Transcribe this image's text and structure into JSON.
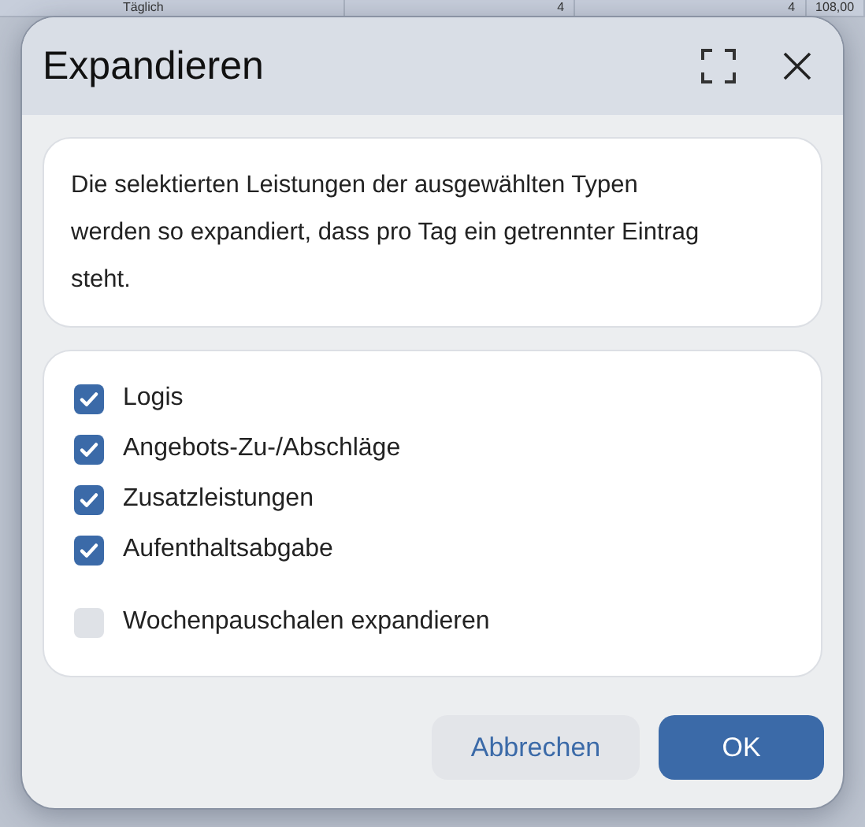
{
  "background_row": {
    "cells": [
      "Täglich",
      "4",
      "4",
      "108,00"
    ]
  },
  "dialog": {
    "title": "Expandieren",
    "description": "Die selektierten Leistungen der ausgewählten Typen werden so expandiert, dass pro Tag ein getrennter Eintrag steht.",
    "options": [
      {
        "label": "Logis",
        "checked": true
      },
      {
        "label": "Angebots-Zu-/Abschläge",
        "checked": true
      },
      {
        "label": "Zusatzleistungen",
        "checked": true
      },
      {
        "label": "Aufenthaltsabgabe",
        "checked": true
      }
    ],
    "extra_option": {
      "label": "Wochenpauschalen expandieren",
      "checked": false
    },
    "buttons": [
      {
        "label": "Abbrechen",
        "kind": "secondary"
      },
      {
        "label": "OK",
        "kind": "primary"
      }
    ]
  }
}
